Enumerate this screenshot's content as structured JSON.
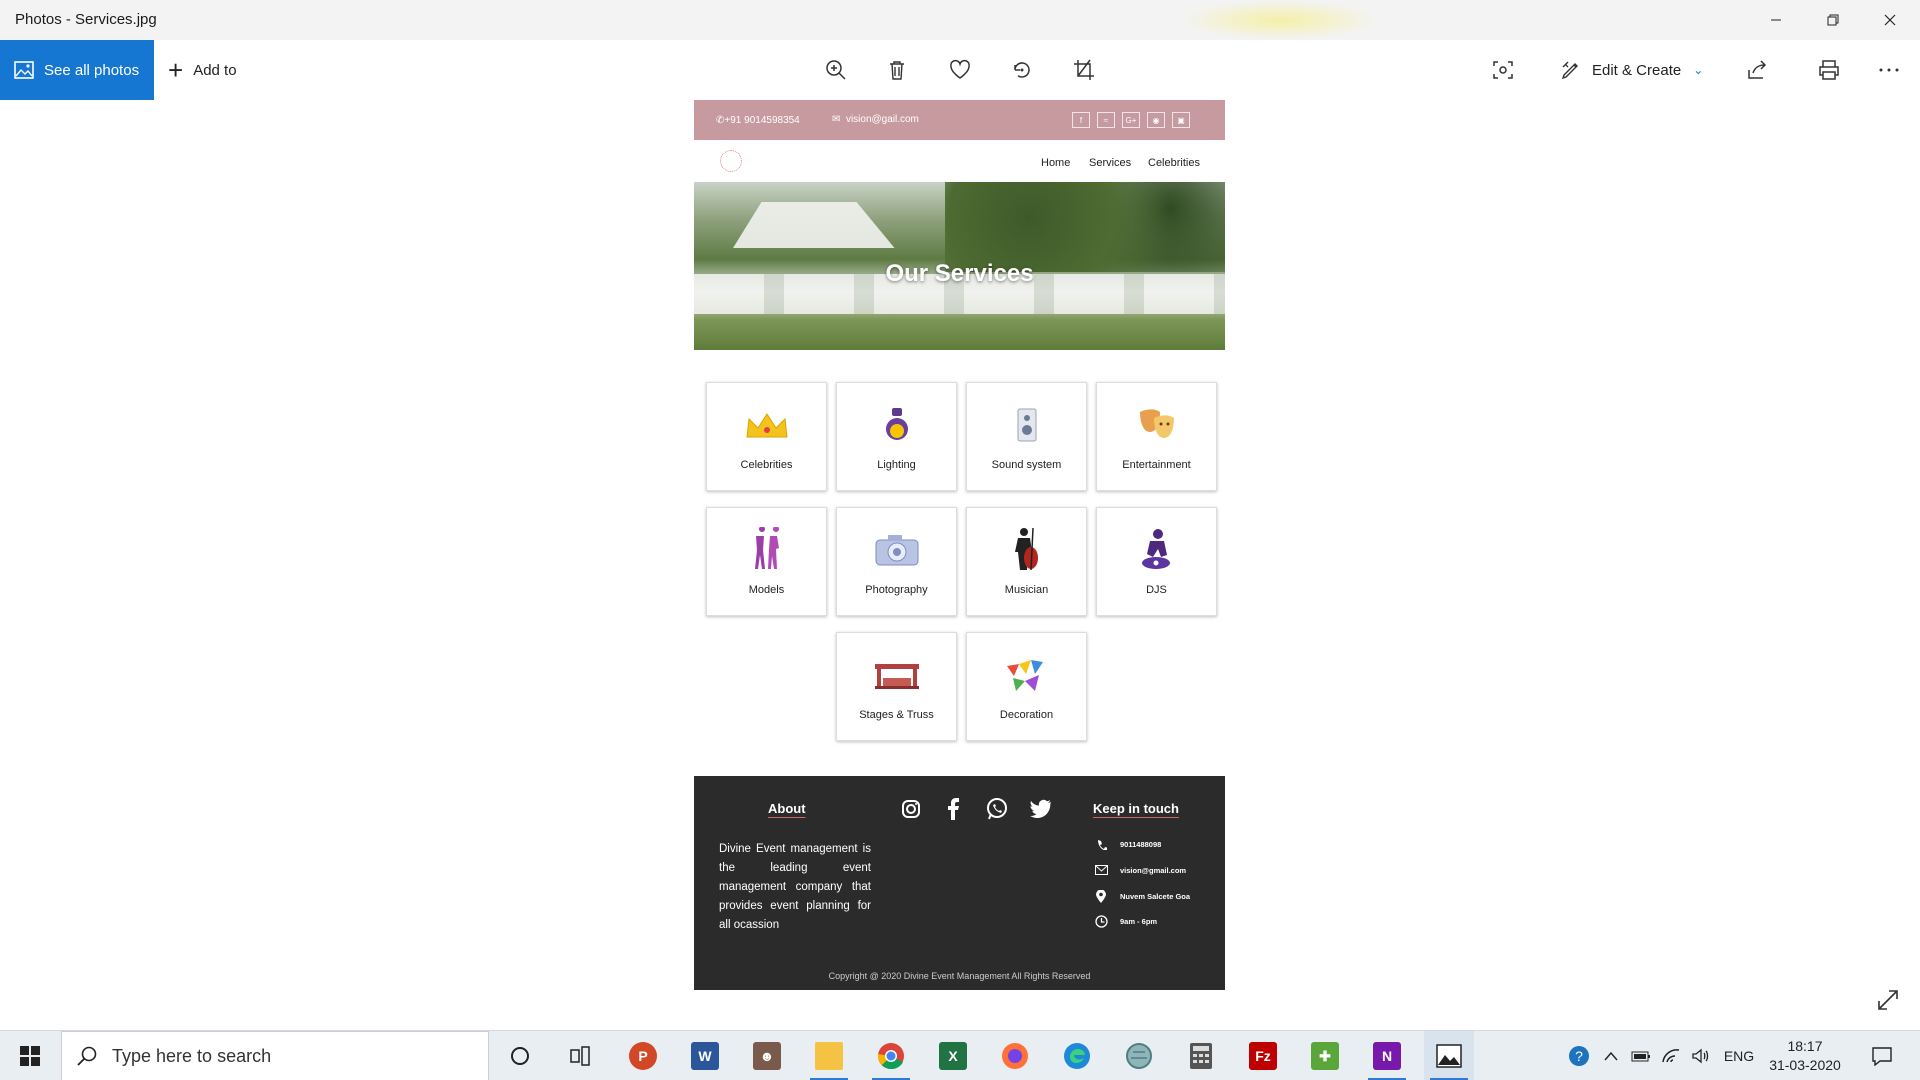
{
  "window": {
    "title": "Photos - Services.jpg"
  },
  "toolbar": {
    "see_all": "See all photos",
    "add_to": "Add to",
    "edit_create": "Edit & Create"
  },
  "site": {
    "topbar": {
      "phone": "+91  9014598354",
      "email": "vision@gail.com",
      "social": [
        "f",
        "rss",
        "G+",
        "eye",
        "cam"
      ]
    },
    "nav": [
      "Home",
      "Services",
      "Celebrities"
    ],
    "hero_title": "Our Services",
    "services": [
      {
        "label": "Celebrities",
        "icon": "crown-icon"
      },
      {
        "label": "Lighting",
        "icon": "light-bulb-icon"
      },
      {
        "label": "Sound system",
        "icon": "speaker-icon"
      },
      {
        "label": "Entertainment",
        "icon": "theatre-masks-icon"
      },
      {
        "label": "Models",
        "icon": "models-icon"
      },
      {
        "label": "Photography",
        "icon": "camera-icon"
      },
      {
        "label": "Musician",
        "icon": "cellist-icon"
      },
      {
        "label": "DJS",
        "icon": "dj-icon"
      },
      {
        "label": "Stages & Truss",
        "icon": "stage-icon"
      },
      {
        "label": "Decoration",
        "icon": "bunting-icon"
      }
    ],
    "footer": {
      "about_heading": "About",
      "about_text": "Divine Event management is the leading event management company that provides event planning for all ocassion",
      "keep_heading": "Keep in touch",
      "contact": {
        "phone": "9011488098",
        "email": "vision@gmail.com",
        "address": "Nuvem Salcete Goa",
        "hours": "9am - 6pm"
      },
      "copyright": "Copyright @ 2020 Divine Event Management All Rights  Reserved"
    }
  },
  "taskbar": {
    "search_placeholder": "Type here to search",
    "apps": [
      "cortana",
      "task-view",
      "powerpoint",
      "word",
      "photo-contact",
      "file-explorer",
      "chrome",
      "excel",
      "firefox",
      "edge",
      "app-globe",
      "calculator",
      "filezilla",
      "app-green",
      "onenote",
      "photos"
    ],
    "language": "ENG",
    "time": "18:17",
    "date": "31-03-2020"
  }
}
